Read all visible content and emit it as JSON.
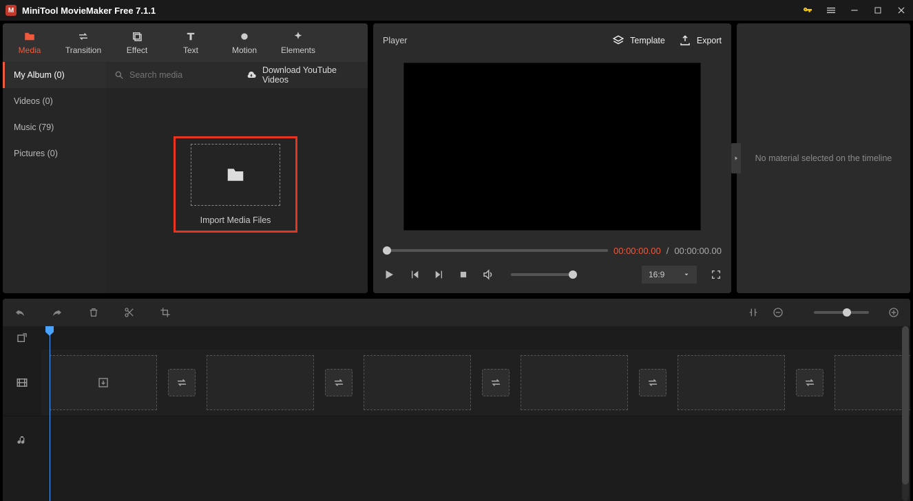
{
  "titlebar": {
    "title": "MiniTool MovieMaker Free 7.1.1"
  },
  "tabs": [
    {
      "label": "Media",
      "icon": "folder"
    },
    {
      "label": "Transition",
      "icon": "swap"
    },
    {
      "label": "Effect",
      "icon": "layers"
    },
    {
      "label": "Text",
      "icon": "text"
    },
    {
      "label": "Motion",
      "icon": "circle"
    },
    {
      "label": "Elements",
      "icon": "sparkle"
    }
  ],
  "media_categories": [
    {
      "label": "My Album (0)",
      "active": true
    },
    {
      "label": "Videos (0)"
    },
    {
      "label": "Music (79)"
    },
    {
      "label": "Pictures (0)"
    }
  ],
  "search": {
    "placeholder": "Search media"
  },
  "youtube_link": "Download YouTube Videos",
  "import": {
    "label": "Import Media Files"
  },
  "player": {
    "title": "Player",
    "template": "Template",
    "export": "Export",
    "time_current": "00:00:00.00",
    "time_sep": " / ",
    "time_total": "00:00:00.00",
    "aspect": "16:9"
  },
  "props": {
    "empty_text": "No material selected on the timeline"
  }
}
